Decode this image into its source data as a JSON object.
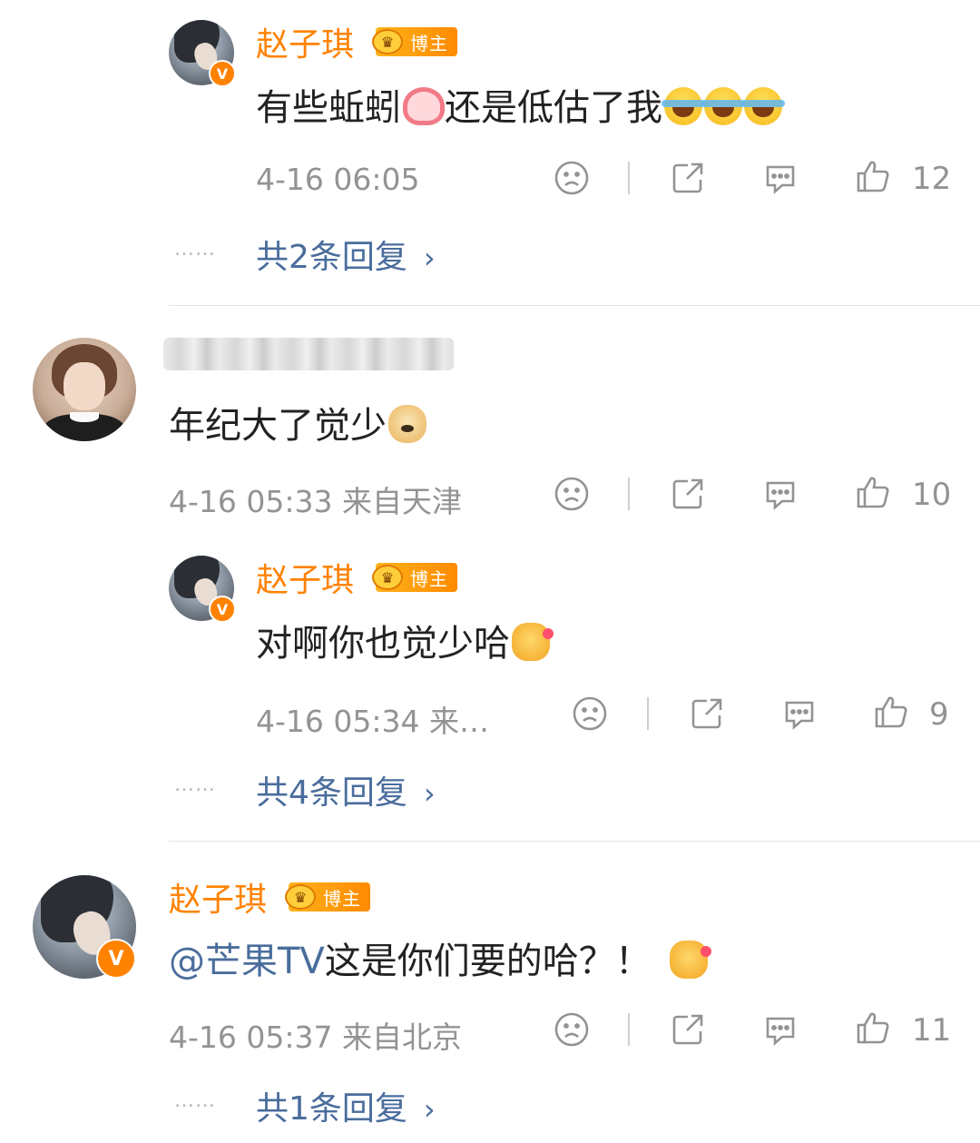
{
  "comments": [
    {
      "author": "赵子琪",
      "badge": "博主",
      "text": "有些蚯蚓",
      "text_after_emoji": "还是低估了我",
      "emojis": [
        "worm-emoji",
        "laugh-cry-emoji",
        "laugh-cry-emoji",
        "laugh-cry-emoji"
      ],
      "time": "4-16 06:05",
      "likes": "12",
      "replies": "共2条回复"
    },
    {
      "author": "",
      "text": "年纪大了觉少",
      "emojis": [
        "doge-emoji"
      ],
      "time": "4-16 05:33 来自天津",
      "likes": "10"
    },
    {
      "author": "赵子琪",
      "badge": "博主",
      "text": "对啊你也觉少哈",
      "emojis": [
        "love-cat-emoji"
      ],
      "time": "4-16 05:34 来…",
      "likes": "9",
      "replies": "共4条回复"
    },
    {
      "author": "赵子琪",
      "badge": "博主",
      "mention": "@芒果TV",
      "text": "这是你们要的哈？！",
      "emojis": [
        "love-cat-emoji"
      ],
      "time": "4-16 05:37 来自北京",
      "likes": "11",
      "replies": "共1条回复"
    }
  ],
  "ui": {
    "dots": "……",
    "chevron": "›",
    "verified": "V"
  },
  "colors": {
    "username": "#ff8200",
    "link": "#4a6d9c",
    "meta": "#939393",
    "badge": "#ff9a00"
  },
  "icons": [
    "sad-face-icon",
    "share-icon",
    "comment-icon",
    "thumbs-up-icon"
  ]
}
